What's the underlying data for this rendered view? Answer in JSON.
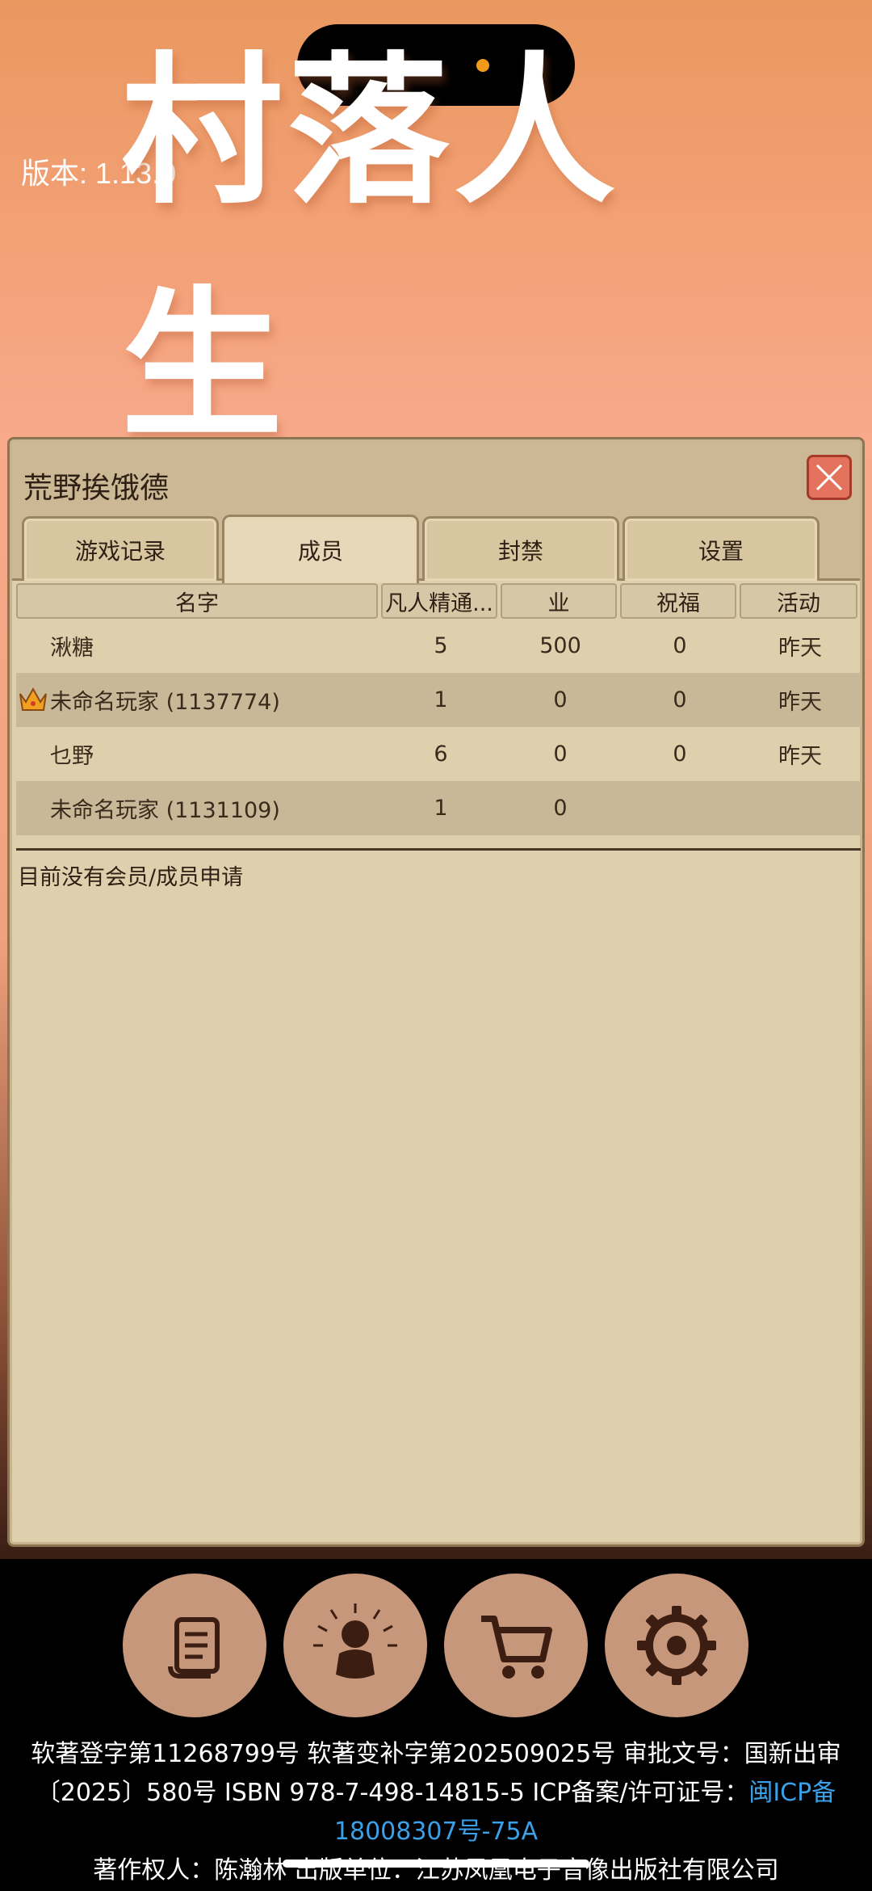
{
  "version_label": "版本: 1.13.0",
  "logo_title": "村落人生",
  "panel": {
    "title": "荒野挨饿德",
    "tabs": [
      "游戏记录",
      "成员",
      "封禁",
      "设置"
    ],
    "active_tab": "成员"
  },
  "table": {
    "headers": [
      "名字",
      "凡人精通...",
      "业",
      "祝福",
      "活动"
    ],
    "rows": [
      {
        "name": "湫糖",
        "mastery": "5",
        "karma": "500",
        "blessing": "0",
        "activity": "昨天",
        "crown": false
      },
      {
        "name": "未命名玩家 (1137774)",
        "mastery": "1",
        "karma": "0",
        "blessing": "0",
        "activity": "昨天",
        "crown": true
      },
      {
        "name": "乜野",
        "mastery": "6",
        "karma": "0",
        "blessing": "0",
        "activity": "昨天",
        "crown": false
      },
      {
        "name": "未命名玩家 (1131109)",
        "mastery": "1",
        "karma": "0",
        "blessing": "",
        "activity": "",
        "crown": false
      }
    ]
  },
  "no_request_text": "目前没有会员/成员申请",
  "bottom_buttons": [
    "scroll-icon",
    "meditation-icon",
    "cart-icon",
    "gear-icon"
  ],
  "footer": {
    "line1": "软著登字第11268799号 软著变补字第202509025号 审批文号：国新出审〔2025〕580号 ISBN 978-7-498-14815-5 ICP备案/许可证号：",
    "icp_link": "闽ICP备18008307号-75A",
    "line2": "著作权人：陈瀚林 出版单位：江苏凤凰电子音像出版社有限公司"
  },
  "colors": {
    "panel_bg": "#dfd0ad",
    "close_button": "#e3735c",
    "circle_button": "#c7977b",
    "link": "#3aa0e8"
  }
}
